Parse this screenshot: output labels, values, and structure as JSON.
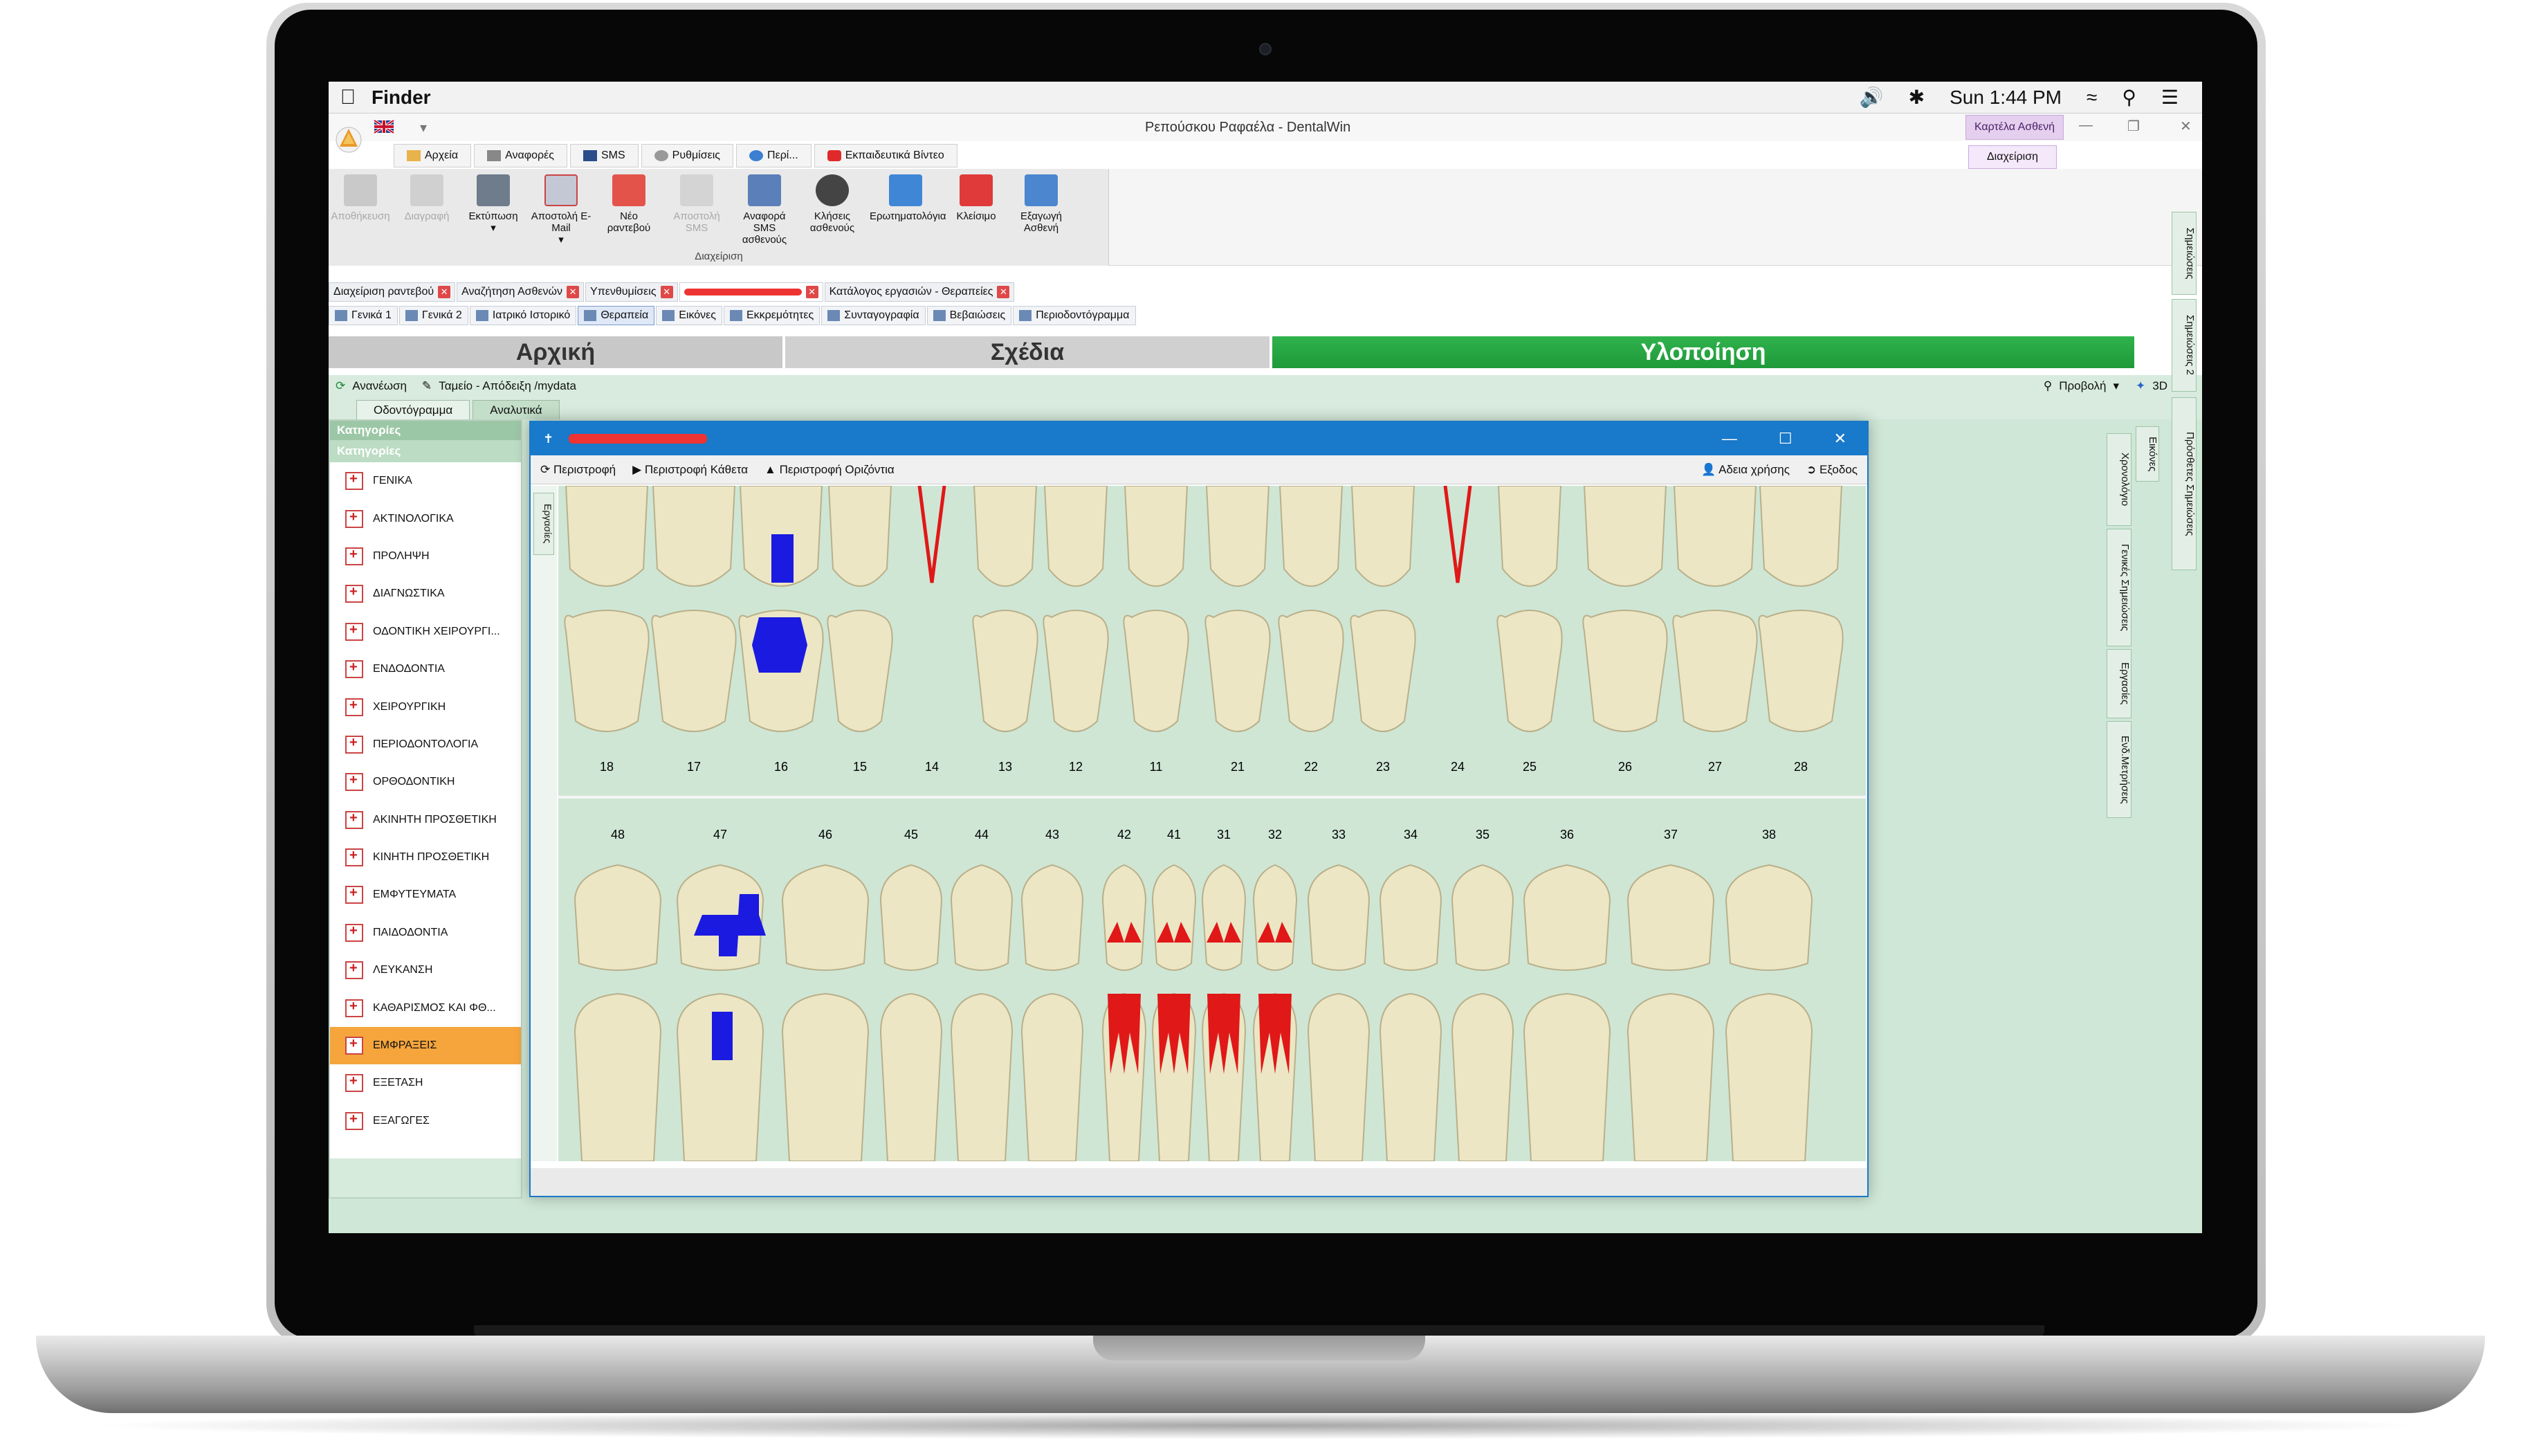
{
  "menubar": {
    "app": "Finder",
    "clock": "Sun 1:44 PM"
  },
  "window": {
    "title": "Ρεπούσκου   Ραφαέλα - DentalWin",
    "patient_card": "Καρτέλα Ασθενή",
    "manage_tab": "Διαχείριση"
  },
  "ribbon_tabs": [
    "Αρχεία",
    "Αναφορές",
    "SMS",
    "Ρυθμίσεις",
    "Περί...",
    "Εκπαιδευτικά Βίντεο"
  ],
  "ribbon_buttons": [
    {
      "label": "Αποθήκευση",
      "enabled": false
    },
    {
      "label": "Διαγραφή",
      "enabled": false
    },
    {
      "label": "Εκτύπωση",
      "enabled": true
    },
    {
      "label": "Αποστολή E-Mail",
      "enabled": true
    },
    {
      "label": "Νέο ραντεβού",
      "enabled": true
    },
    {
      "label": "Αποστολή SMS",
      "enabled": false
    },
    {
      "label": "Αναφορά SMS ασθενούς",
      "enabled": true
    },
    {
      "label": "Κλήσεις ασθενούς",
      "enabled": true
    },
    {
      "label": "Ερωτηματολόγια",
      "enabled": true
    },
    {
      "label": "Κλείσιμο",
      "enabled": true
    },
    {
      "label": "Εξαγωγή Ασθενή",
      "enabled": true
    }
  ],
  "ribbon_group_label": "Διαχείριση",
  "doc_tabs": [
    "Διαχείριση ραντεβού",
    "Αναζήτηση Ασθενών",
    "Υπενθυμίσεις",
    "",
    "Κατάλογος εργασιών - Θεραπείες"
  ],
  "sub_tabs": [
    "Γενικά 1",
    "Γενικά 2",
    "Ιατρικό Ιστορικό",
    "Θεραπεία",
    "Εικόνες",
    "Εκκρεμότητες",
    "Συνταγογραφία",
    "Βεβαιώσεις",
    "Περιοδοντόγραμμα"
  ],
  "phases": [
    "Αρχική",
    "Σχέδια",
    "Υλοποίηση"
  ],
  "toolbar": {
    "refresh": "Ανανέωση",
    "cashier": "Ταμείο - Απόδειξη /mydata",
    "view": "Προβολή",
    "three_d": "3D"
  },
  "view_tabs": [
    "Οδοντόγραμμα",
    "Αναλυτικά"
  ],
  "sidebar": {
    "header": "Κατηγορίες",
    "subheader": "Κατηγορίες",
    "items": [
      "ΓΕΝΙΚΑ",
      "ΑΚΤΙΝΟΛΟΓΙΚΑ",
      "ΠΡΟΛΗΨΗ",
      "ΔΙΑΓΝΩΣΤΙΚΑ",
      "ΟΔΟΝΤΙΚΗ ΧΕΙΡΟΥΡΓΙ...",
      "ΕΝΔΟΔΟΝΤΙΑ",
      "ΧΕΙΡΟΥΡΓΙΚΗ",
      "ΠΕΡΙΟΔΟΝΤΟΛΟΓΙΑ",
      "ΟΡΘΟΔΟΝΤΙΚΗ",
      "ΑΚΙΝΗΤΗ ΠΡΟΣΘΕΤΙΚΗ",
      "ΚΙΝΗΤΗ ΠΡΟΣΘΕΤΙΚΗ",
      "ΕΜΦΥΤΕΥΜΑΤΑ",
      "ΠΑΙΔΟΔΟΝΤΙΑ",
      "ΛΕΥΚΑΝΣΗ",
      "ΚΑΘΑΡΙΣΜΟΣ ΚΑΙ ΦΘ...",
      "ΕΜΦΡΑΞΕΙΣ",
      "ΕΞΕΤΑΣΗ",
      "ΕΞΑΓΩΓΕΣ"
    ],
    "selected": "ΕΜΦΡΑΞΕΙΣ"
  },
  "dialog": {
    "tools": [
      "Περιστροφή",
      "Περιστροφή Κάθετα",
      "Περιστροφή Οριζόντια"
    ],
    "right_tools": [
      "Αδεια χρήσης",
      "Εξοδος"
    ],
    "side_tab": "Εργασίες",
    "upper_numbers": [
      "18",
      "17",
      "16",
      "15",
      "14",
      "13",
      "12",
      "11",
      "21",
      "22",
      "23",
      "24",
      "25",
      "26",
      "27",
      "28"
    ],
    "lower_numbers": [
      "48",
      "47",
      "46",
      "45",
      "44",
      "43",
      "42",
      "41",
      "31",
      "32",
      "33",
      "34",
      "35",
      "36",
      "37",
      "38"
    ]
  },
  "right_tabs": [
    "Χρονολόγιο",
    "Γενικές Σημειώσεις",
    "Εργασίες",
    "Ενδ.Μετρήσεις",
    "Εικόνες"
  ],
  "far_right_tabs": [
    "Σημειώσεις",
    "Σημειώσεις 2",
    "Πρόσθετες Σημειώσεις"
  ],
  "colors": {
    "accent_blue": "#1979ca",
    "green_phase": "#1f9a3a",
    "selected_orange": "#f5a53c",
    "restoration_blue": "#1a1ae0",
    "marker_red": "#e01818"
  }
}
